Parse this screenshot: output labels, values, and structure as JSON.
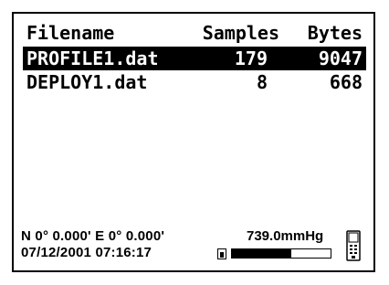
{
  "table": {
    "headers": {
      "name": "Filename",
      "samples": "Samples",
      "bytes": "Bytes"
    },
    "rows": [
      {
        "name": "PROFILE1.dat",
        "samples": "179",
        "bytes": "9047",
        "selected": true
      },
      {
        "name": "DEPLOY1.dat",
        "samples": "8",
        "bytes": "668",
        "selected": false
      }
    ]
  },
  "status": {
    "gps": "N 0° 0.000' E  0° 0.000'",
    "datetime": "07/12/2001 07:16:17",
    "pressure": "739.0mmHg",
    "battery_level": 0.6,
    "battery_icon": "battery-icon",
    "device_icon": "handheld-device-icon"
  }
}
